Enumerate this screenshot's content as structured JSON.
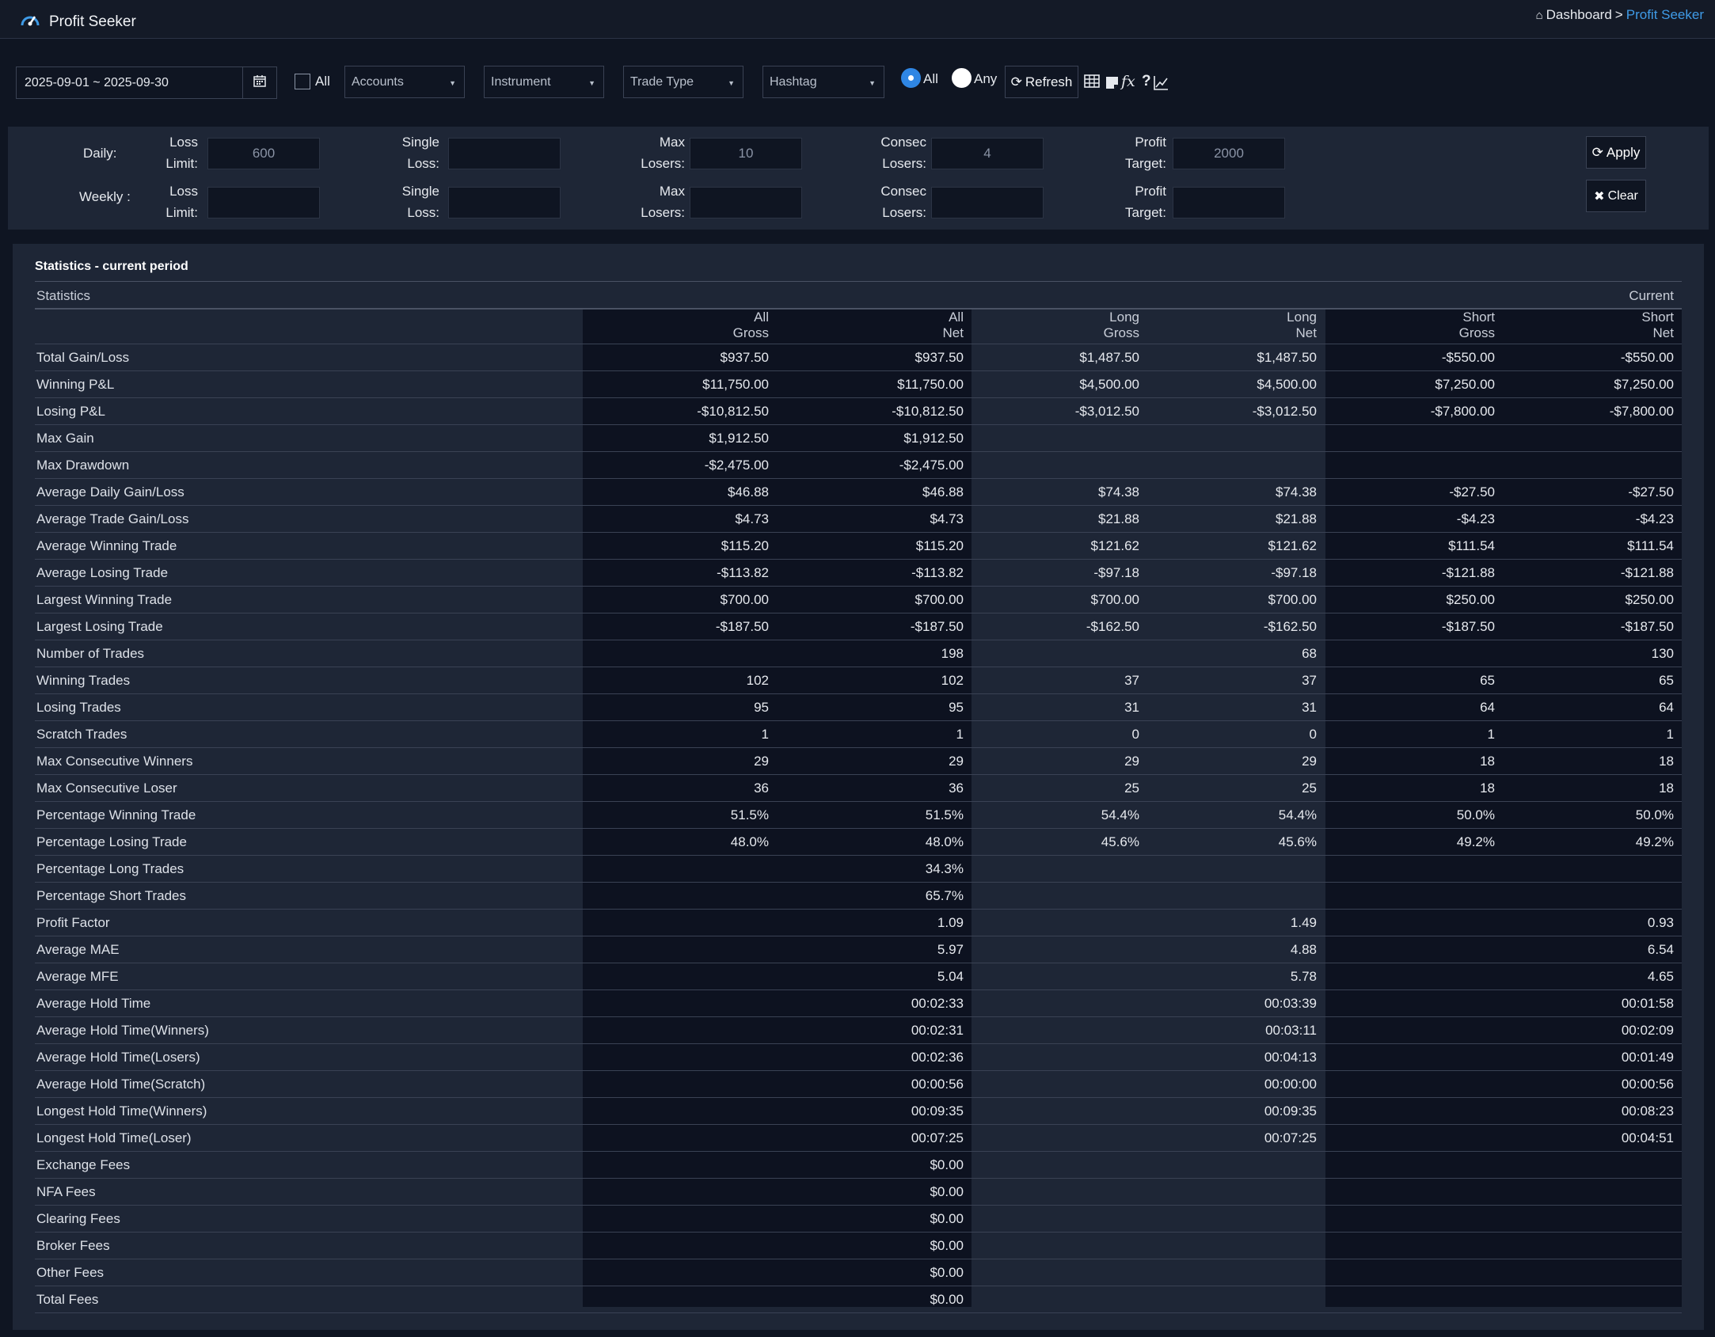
{
  "app": {
    "title": "Profit Seeker"
  },
  "breadcrumb": {
    "home": "Dashboard",
    "separator": ">",
    "current": "Profit Seeker"
  },
  "filters": {
    "date_range": "2025-09-01 ~ 2025-09-30",
    "all_label": "All",
    "accounts": "Accounts",
    "instrument": "Instrument",
    "trade_type": "Trade Type",
    "hashtag": "Hashtag",
    "match_all": "All",
    "match_any": "Any",
    "refresh": "Refresh",
    "selected_match": "All"
  },
  "limits": {
    "daily_label": "Daily:",
    "weekly_label": "Weekly :",
    "loss_limit": [
      "Loss",
      "Limit:"
    ],
    "single_loss": [
      "Single",
      "Loss:"
    ],
    "max_losers": [
      "Max",
      "Losers:"
    ],
    "consec_losers": [
      "Consec",
      "Losers:"
    ],
    "profit_target": [
      "Profit",
      "Target:"
    ],
    "daily_values": {
      "loss_limit": "600",
      "single_loss": "",
      "max_losers": "10",
      "consec_losers": "4",
      "profit_target": "2000"
    },
    "weekly_values": {
      "loss_limit": "",
      "single_loss": "",
      "max_losers": "",
      "consec_losers": "",
      "profit_target": ""
    },
    "apply": "Apply",
    "clear": "Clear"
  },
  "stats": {
    "title": "Statistics - current period",
    "header_left": "Statistics",
    "header_right": "Current",
    "columns": [
      [
        "All",
        "Gross"
      ],
      [
        "All",
        "Net"
      ],
      [
        "Long",
        "Gross"
      ],
      [
        "Long",
        "Net"
      ],
      [
        "Short",
        "Gross"
      ],
      [
        "Short",
        "Net"
      ]
    ],
    "rows": [
      [
        "Total Gain/Loss",
        "$937.50",
        "$937.50",
        "$1,487.50",
        "$1,487.50",
        "-$550.00",
        "-$550.00"
      ],
      [
        "Winning P&L",
        "$11,750.00",
        "$11,750.00",
        "$4,500.00",
        "$4,500.00",
        "$7,250.00",
        "$7,250.00"
      ],
      [
        "Losing P&L",
        "-$10,812.50",
        "-$10,812.50",
        "-$3,012.50",
        "-$3,012.50",
        "-$7,800.00",
        "-$7,800.00"
      ],
      [
        "Max Gain",
        "$1,912.50",
        "$1,912.50",
        "",
        "",
        "",
        ""
      ],
      [
        "Max Drawdown",
        "-$2,475.00",
        "-$2,475.00",
        "",
        "",
        "",
        ""
      ],
      [
        "Average Daily Gain/Loss",
        "$46.88",
        "$46.88",
        "$74.38",
        "$74.38",
        "-$27.50",
        "-$27.50"
      ],
      [
        "Average Trade Gain/Loss",
        "$4.73",
        "$4.73",
        "$21.88",
        "$21.88",
        "-$4.23",
        "-$4.23"
      ],
      [
        "Average Winning Trade",
        "$115.20",
        "$115.20",
        "$121.62",
        "$121.62",
        "$111.54",
        "$111.54"
      ],
      [
        "Average Losing Trade",
        "-$113.82",
        "-$113.82",
        "-$97.18",
        "-$97.18",
        "-$121.88",
        "-$121.88"
      ],
      [
        "Largest Winning Trade",
        "$700.00",
        "$700.00",
        "$700.00",
        "$700.00",
        "$250.00",
        "$250.00"
      ],
      [
        "Largest Losing Trade",
        "-$187.50",
        "-$187.50",
        "-$162.50",
        "-$162.50",
        "-$187.50",
        "-$187.50"
      ],
      [
        "Number of Trades",
        "",
        "198",
        "",
        "68",
        "",
        "130"
      ],
      [
        "Winning Trades",
        "102",
        "102",
        "37",
        "37",
        "65",
        "65"
      ],
      [
        "Losing Trades",
        "95",
        "95",
        "31",
        "31",
        "64",
        "64"
      ],
      [
        "Scratch Trades",
        "1",
        "1",
        "0",
        "0",
        "1",
        "1"
      ],
      [
        "Max Consecutive Winners",
        "29",
        "29",
        "29",
        "29",
        "18",
        "18"
      ],
      [
        "Max Consecutive Loser",
        "36",
        "36",
        "25",
        "25",
        "18",
        "18"
      ],
      [
        "Percentage Winning Trade",
        "51.5%",
        "51.5%",
        "54.4%",
        "54.4%",
        "50.0%",
        "50.0%"
      ],
      [
        "Percentage Losing Trade",
        "48.0%",
        "48.0%",
        "45.6%",
        "45.6%",
        "49.2%",
        "49.2%"
      ],
      [
        "Percentage Long Trades",
        "",
        "34.3%",
        "",
        "",
        "",
        ""
      ],
      [
        "Percentage Short Trades",
        "",
        "65.7%",
        "",
        "",
        "",
        ""
      ],
      [
        "Profit Factor",
        "",
        "1.09",
        "",
        "1.49",
        "",
        "0.93"
      ],
      [
        "Average MAE",
        "",
        "5.97",
        "",
        "4.88",
        "",
        "6.54"
      ],
      [
        "Average MFE",
        "",
        "5.04",
        "",
        "5.78",
        "",
        "4.65"
      ],
      [
        "Average Hold Time",
        "",
        "00:02:33",
        "",
        "00:03:39",
        "",
        "00:01:58"
      ],
      [
        "Average Hold Time(Winners)",
        "",
        "00:02:31",
        "",
        "00:03:11",
        "",
        "00:02:09"
      ],
      [
        "Average Hold Time(Losers)",
        "",
        "00:02:36",
        "",
        "00:04:13",
        "",
        "00:01:49"
      ],
      [
        "Average Hold Time(Scratch)",
        "",
        "00:00:56",
        "",
        "00:00:00",
        "",
        "00:00:56"
      ],
      [
        "Longest Hold Time(Winners)",
        "",
        "00:09:35",
        "",
        "00:09:35",
        "",
        "00:08:23"
      ],
      [
        "Longest Hold Time(Loser)",
        "",
        "00:07:25",
        "",
        "00:07:25",
        "",
        "00:04:51"
      ],
      [
        "Exchange Fees",
        "",
        "$0.00",
        "",
        "",
        "",
        ""
      ],
      [
        "NFA Fees",
        "",
        "$0.00",
        "",
        "",
        "",
        ""
      ],
      [
        "Clearing Fees",
        "",
        "$0.00",
        "",
        "",
        "",
        ""
      ],
      [
        "Broker Fees",
        "",
        "$0.00",
        "",
        "",
        "",
        ""
      ],
      [
        "Other Fees",
        "",
        "$0.00",
        "",
        "",
        "",
        ""
      ],
      [
        "Total Fees",
        "",
        "$0.00",
        "",
        "",
        "",
        ""
      ]
    ]
  },
  "colors": {
    "background": "#0f1522",
    "panel": "#1e2636",
    "accent": "#3f9be7",
    "band": "#0d1220"
  }
}
